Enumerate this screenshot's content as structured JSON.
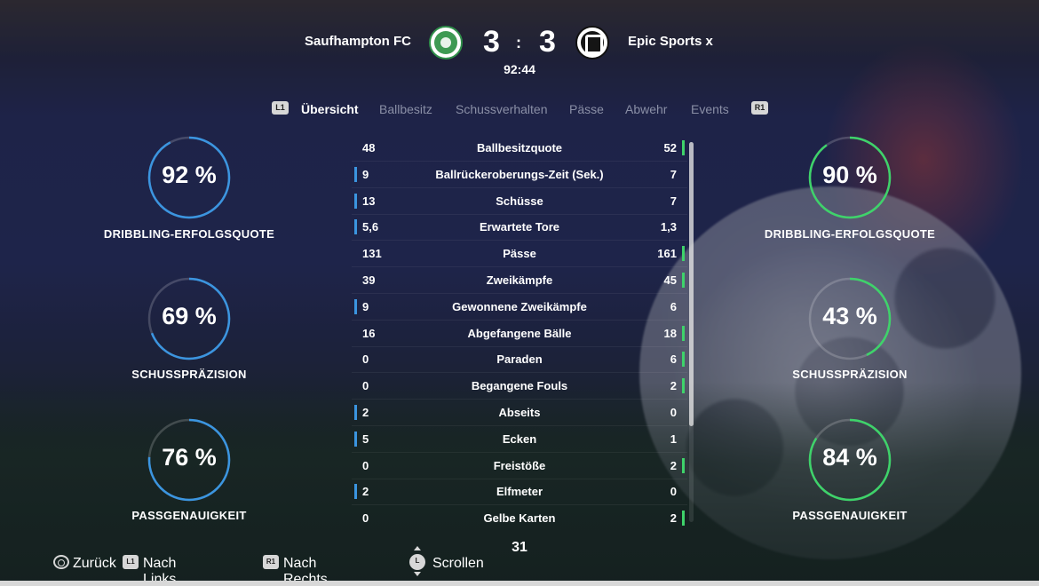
{
  "match": {
    "home_team": "Saufhampton FC",
    "away_team": "Epic Sports x",
    "home_score": "3",
    "away_score": "3",
    "separator": ":",
    "clock": "92:44"
  },
  "tabs": {
    "left_shoulder": "L1",
    "right_shoulder": "R1",
    "items": [
      "Übersicht",
      "Ballbesitz",
      "Schussverhalten",
      "Pässe",
      "Abwehr",
      "Events"
    ],
    "active_index": 0
  },
  "home_gauges": [
    {
      "value": "92 %",
      "fraction": 0.92,
      "label": "DRIBBLING-ERFOLGSQUOTE"
    },
    {
      "value": "69 %",
      "fraction": 0.69,
      "label": "SCHUSSPRÄZISION"
    },
    {
      "value": "76 %",
      "fraction": 0.76,
      "label": "PASSGENAUIGKEIT"
    }
  ],
  "away_gauges": [
    {
      "value": "90 %",
      "fraction": 0.9,
      "label": "DRIBBLING-ERFOLGSQUOTE"
    },
    {
      "value": "43 %",
      "fraction": 0.43,
      "label": "SCHUSSPRÄZISION"
    },
    {
      "value": "84 %",
      "fraction": 0.84,
      "label": "PASSGENAUIGKEIT"
    }
  ],
  "stats": [
    {
      "home": "48",
      "label": "Ballbesitzquote",
      "away": "52",
      "leader": "away"
    },
    {
      "home": "9",
      "label": "Ballrückeroberungs-Zeit (Sek.)",
      "away": "7",
      "leader": "home"
    },
    {
      "home": "13",
      "label": "Schüsse",
      "away": "7",
      "leader": "home"
    },
    {
      "home": "5,6",
      "label": "Erwartete Tore",
      "away": "1,3",
      "leader": "home"
    },
    {
      "home": "131",
      "label": "Pässe",
      "away": "161",
      "leader": "away"
    },
    {
      "home": "39",
      "label": "Zweikämpfe",
      "away": "45",
      "leader": "away"
    },
    {
      "home": "9",
      "label": "Gewonnene Zweikämpfe",
      "away": "6",
      "leader": "home"
    },
    {
      "home": "16",
      "label": "Abgefangene Bälle",
      "away": "18",
      "leader": "away"
    },
    {
      "home": "0",
      "label": "Paraden",
      "away": "6",
      "leader": "away"
    },
    {
      "home": "0",
      "label": "Begangene Fouls",
      "away": "2",
      "leader": "away"
    },
    {
      "home": "2",
      "label": "Abseits",
      "away": "0",
      "leader": "home"
    },
    {
      "home": "5",
      "label": "Ecken",
      "away": "1",
      "leader": "home"
    },
    {
      "home": "0",
      "label": "Freistöße",
      "away": "2",
      "leader": "away"
    },
    {
      "home": "2",
      "label": "Elfmeter",
      "away": "0",
      "leader": "home"
    },
    {
      "home": "0",
      "label": "Gelbe Karten",
      "away": "2",
      "leader": "away"
    }
  ],
  "page_number": "31",
  "footer": {
    "back_label": "Zurück",
    "left_icon": "L1",
    "left_label": "Nach Links wechseln",
    "right_icon": "R1",
    "right_label": "Nach Rechts wechseln",
    "scroll_icon": "L",
    "scroll_label": "Scrollen"
  },
  "colors": {
    "home_accent": "#3b95e0",
    "away_accent": "#3ed36a"
  },
  "icons": {
    "home_crest": "celtic-crest-icon",
    "away_crest": "lugano-crest-icon",
    "back": "circle-button-icon",
    "scroll": "left-stick-icon"
  }
}
